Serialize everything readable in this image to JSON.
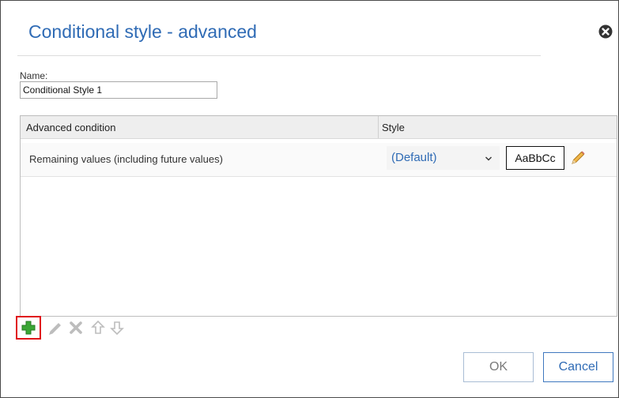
{
  "dialog": {
    "title": "Conditional style - advanced",
    "close_icon": "close-circle-icon"
  },
  "name": {
    "label": "Name:",
    "value": "Conditional Style 1"
  },
  "grid": {
    "columns": [
      "Advanced condition",
      "Style"
    ],
    "rows": [
      {
        "condition": "Remaining values (including future values)",
        "style_selected": "(Default)",
        "style_preview": "AaBbCc",
        "edit_icon": "pencil-icon"
      }
    ]
  },
  "toolbar": {
    "buttons": [
      {
        "name": "add",
        "icon": "plus-icon",
        "enabled": true,
        "highlighted": true
      },
      {
        "name": "edit",
        "icon": "pencil-icon",
        "enabled": false
      },
      {
        "name": "delete",
        "icon": "x-icon",
        "enabled": false
      },
      {
        "name": "move-up",
        "icon": "arrow-up-icon",
        "enabled": false
      },
      {
        "name": "move-down",
        "icon": "arrow-down-icon",
        "enabled": false
      }
    ]
  },
  "footer": {
    "ok_label": "OK",
    "cancel_label": "Cancel"
  },
  "colors": {
    "accent": "#2f6bb5",
    "highlight_border": "#e0131a",
    "add_icon": "#3aa635"
  }
}
